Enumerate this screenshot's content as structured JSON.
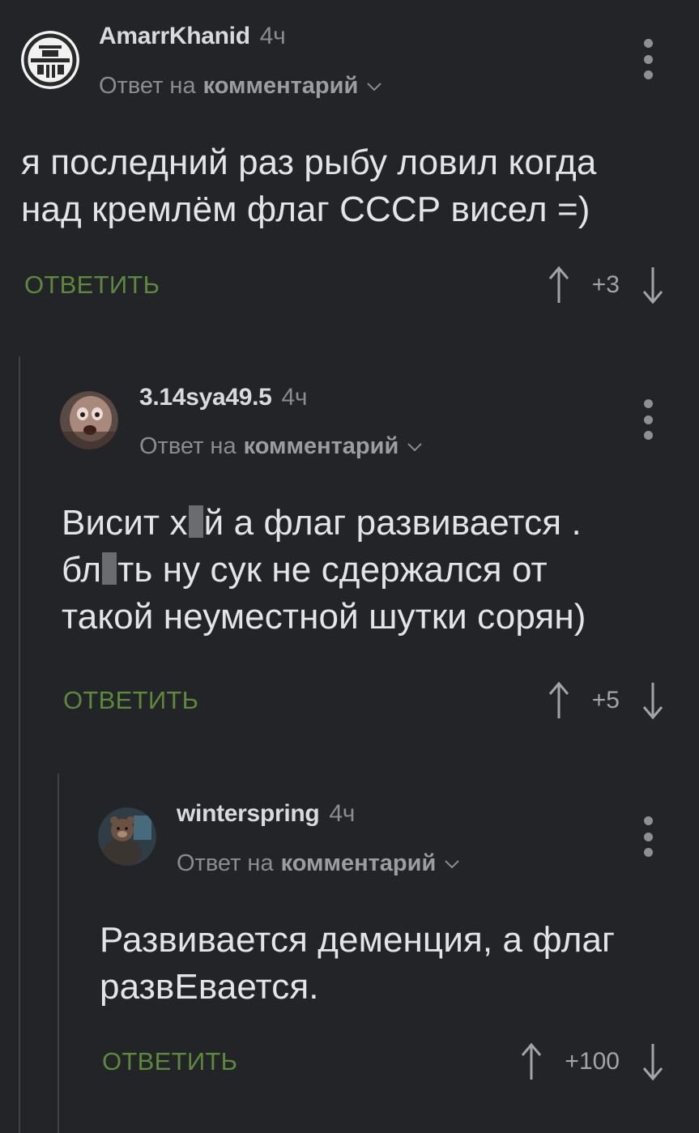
{
  "comments": [
    {
      "author": "AmarrKhanid",
      "time": "4ч",
      "reply_prefix": "Ответ на",
      "reply_target": "комментарий",
      "text": "я последний раз рыбу ловил когда\nнад кремлём флаг СССР висел =)",
      "reply_label": "ОТВЕТИТЬ",
      "score": "+3"
    },
    {
      "author": "3.14sya49.5",
      "time": "4ч",
      "reply_prefix": "Ответ на",
      "reply_target": "комментарий",
      "line1_a": "Висит х",
      "line1_b": "й а флаг развивается .",
      "line2_a": "бл",
      "line2_b": "ть ну сук не сдержался от",
      "line3": "такой неуместной шутки сорян)",
      "reply_label": "ОТВЕТИТЬ",
      "score": "+5"
    },
    {
      "author": "winterspring",
      "time": "4ч",
      "reply_prefix": "Ответ на",
      "reply_target": "комментарий",
      "text": "Развивается деменция, а флаг\nразвЕвается.",
      "reply_label": "ОТВЕТИТЬ",
      "score": "+100"
    }
  ],
  "colors": {
    "background": "#232427",
    "accent_green": "#5b8a3a",
    "muted": "#8b8c8f"
  }
}
